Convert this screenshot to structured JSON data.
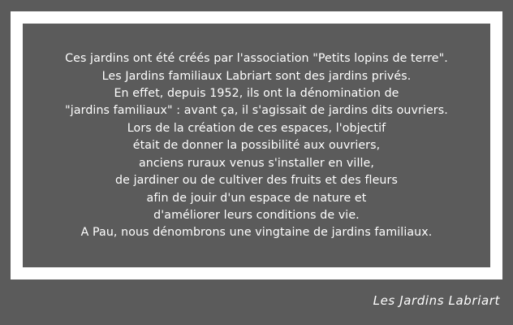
{
  "paragraph": {
    "lines": [
      "Ces jardins ont été créés par l'association \"Petits lopins de terre\".",
      "Les Jardins familiaux Labriart sont des jardins privés.",
      "En effet, depuis 1952, ils ont la dénomination de",
      "\"jardins familiaux\" : avant ça, il s'agissait de jardins dits ouvriers.",
      "Lors de la création de ces espaces, l'objectif",
      "était de donner la possibilité aux ouvriers,",
      "anciens ruraux venus s'installer en ville,",
      "de jardiner ou de cultiver des fruits et des fleurs",
      "afin de jouir d'un espace de nature et",
      "d'améliorer leurs conditions de vie.",
      "A Pau, nous dénombrons une vingtaine de jardins familiaux."
    ]
  },
  "caption": "Les Jardins Labriart",
  "colors": {
    "background": "#5b5b5b",
    "frame": "#ffffff",
    "text": "#ffffff"
  }
}
